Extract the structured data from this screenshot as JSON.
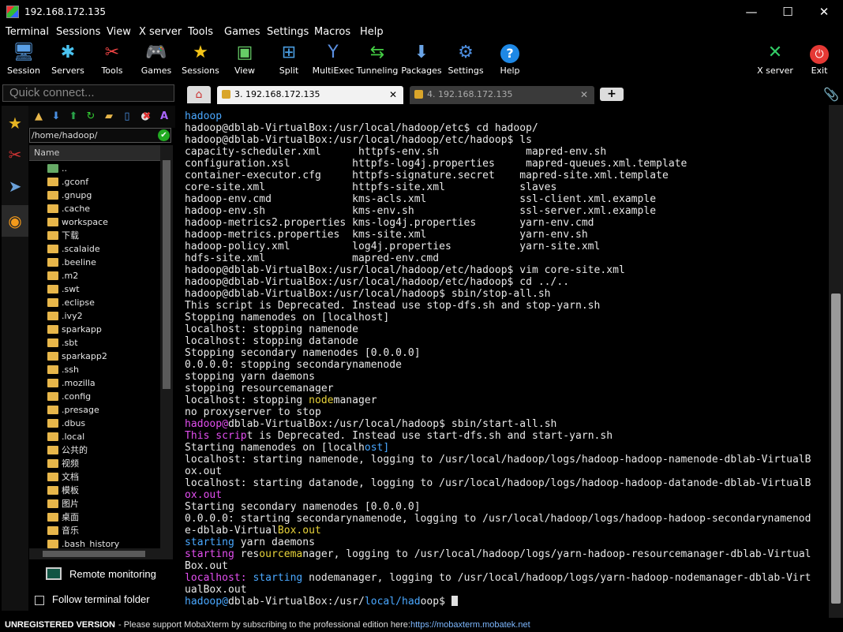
{
  "window": {
    "title": "192.168.172.135",
    "minimize": "—",
    "maximize": "☐",
    "close": "✕"
  },
  "menu": [
    "Terminal",
    "Sessions",
    "View",
    "X server",
    "Tools",
    "Games",
    "Settings",
    "Macros",
    "Help"
  ],
  "toolbar": {
    "items": [
      {
        "label": "Session",
        "icon": "monitor-icon"
      },
      {
        "label": "Servers",
        "icon": "servers-icon"
      },
      {
        "label": "Tools",
        "icon": "tools-icon"
      },
      {
        "label": "Games",
        "icon": "gamepad-icon"
      },
      {
        "label": "Sessions",
        "icon": "star-icon"
      },
      {
        "label": "View",
        "icon": "view-icon"
      },
      {
        "label": "Split",
        "icon": "split-icon"
      },
      {
        "label": "MultiExec",
        "icon": "multiexec-icon"
      },
      {
        "label": "Tunneling",
        "icon": "tunneling-icon"
      },
      {
        "label": "Packages",
        "icon": "packages-icon"
      },
      {
        "label": "Settings",
        "icon": "gears-icon"
      },
      {
        "label": "Help",
        "icon": "help-icon"
      }
    ],
    "xserver": "X server",
    "exit": "Exit"
  },
  "quick_connect": {
    "placeholder": "Quick connect..."
  },
  "sidebar": {
    "path": "/home/hadoop/",
    "column": "Name",
    "files": [
      "..",
      ".gconf",
      ".gnupg",
      ".cache",
      "workspace",
      "下载",
      ".scalaide",
      ".beeline",
      ".m2",
      ".swt",
      ".eclipse",
      ".ivy2",
      "sparkapp",
      ".sbt",
      "sparkapp2",
      ".ssh",
      ".mozilla",
      ".config",
      ".presage",
      ".dbus",
      ".local",
      "公共的",
      "视频",
      "文档",
      "模板",
      "图片",
      "桌面",
      "音乐",
      ".bash_history"
    ],
    "remote_monitoring": "Remote monitoring",
    "follow_terminal": "Follow terminal folder"
  },
  "tabs": {
    "active": "3. 192.168.172.135",
    "inactive": "4. 192.168.172.135",
    "close": "✕",
    "add": "+"
  },
  "terminal": {
    "lines": [
      [
        [
          "hadoop",
          "bl"
        ]
      ],
      [
        [
          "hadoop@dblab-VirtualBox:/usr/local/hadoop/etc$ cd hadoop/",
          ""
        ]
      ],
      [
        [
          "hadoop@dblab-VirtualBox:/usr/local/hadoop/etc/hadoop$ ls",
          ""
        ]
      ],
      [
        [
          "capacity-scheduler.xml      httpfs-env.sh              mapred-env.sh",
          ""
        ]
      ],
      [
        [
          "configuration.xsl          httpfs-",
          ""
        ],
        [
          "log4j",
          ""
        ],
        [
          ".properties     mapred-queues.xml.template",
          ""
        ]
      ],
      [
        [
          "container-executor.cfg     httpfs-signature.secret    mapred-site.xml.template",
          ""
        ]
      ],
      [
        [
          "core-site.xml              httpfs-site.xml            slaves",
          ""
        ]
      ],
      [
        [
          "hadoop-env.cmd             kms-acls.xml               ssl-client.xml.example",
          ""
        ]
      ],
      [
        [
          "hadoop-env.sh              kms-env.sh                 ssl-server.xml.example",
          ""
        ]
      ],
      [
        [
          "hadoop-metrics2.properties kms-log4j.properties       yarn-env.cmd",
          ""
        ]
      ],
      [
        [
          "hadoop-metrics.properties  kms-site.xml               yarn-env.sh",
          ""
        ]
      ],
      [
        [
          "hadoop-policy.xml          log4j.properties           yarn-site.xml",
          ""
        ]
      ],
      [
        [
          "hdfs-site.xml              mapred-env.cmd",
          ""
        ]
      ],
      [
        [
          "hadoop@dblab-VirtualBox:/usr/local/hadoop/etc/hadoop$ vim core-site.xml",
          ""
        ]
      ],
      [
        [
          "hadoop@dblab-VirtualBox:/usr/local/hadoop/etc/hadoop$ cd ../..",
          ""
        ]
      ],
      [
        [
          "hadoop@dblab-VirtualBox:/usr/local/hadoop$ sbin/stop-all.sh",
          ""
        ]
      ],
      [
        [
          "This script is Deprecated. Instead use stop-dfs.sh and stop-yarn.sh",
          ""
        ]
      ],
      [
        [
          "Stopping namenodes on [localhost]",
          ""
        ]
      ],
      [
        [
          "localhost: stopping namenode",
          ""
        ]
      ],
      [
        [
          "localhost: stopping datanode",
          ""
        ]
      ],
      [
        [
          "Stopping secondary namenodes [0.0.0.0]",
          ""
        ]
      ],
      [
        [
          "0.0.0.0: stopping secondarynamenode",
          ""
        ]
      ],
      [
        [
          "stopping yarn daemons",
          ""
        ]
      ],
      [
        [
          "stopping resourcemanager",
          ""
        ]
      ],
      [
        [
          "localhost: stop",
          ""
        ],
        [
          "ping ",
          ""
        ],
        [
          "node",
          "yl"
        ],
        [
          "manager",
          ""
        ]
      ],
      [
        [
          "no proxyserver to stop",
          ""
        ]
      ],
      [
        [
          "hadoop@",
          "mg"
        ],
        [
          "dblab-VirtualBox:/usr/local/hadoop$ sbin/start-all.sh",
          ""
        ]
      ],
      [
        [
          "This scrip",
          "mg"
        ],
        [
          "t is Deprecated. Instead use start-dfs.sh and start-yarn.sh",
          ""
        ]
      ],
      [
        [
          "Starting namenodes on [localh",
          ""
        ],
        [
          "ost]",
          "bl"
        ]
      ],
      [
        [
          "localhost: starting namenode, logging to /usr/local/hadoop/logs/hadoop-hadoop-namenode-dblab-VirtualB",
          ""
        ]
      ],
      [
        [
          "ox.out",
          ""
        ]
      ],
      [
        [
          "localhost: starting datanode, logging to /usr/local/hadoop/logs/hadoop-hadoop-datanode-dblab-VirtualB",
          ""
        ]
      ],
      [
        [
          "ox.out",
          "mg"
        ]
      ],
      [
        [
          "Starting secondary namenodes [0.0.0.0]",
          ""
        ]
      ],
      [
        [
          "0.0.0.0: starting secondarynamenode, logging to /usr/local/hadoop/logs/hadoop-hadoop-secondarynamenod",
          ""
        ]
      ],
      [
        [
          "e-dblab-Virtual",
          ""
        ],
        [
          "Box.out",
          "yl"
        ]
      ],
      [
        [
          "starting",
          "bl"
        ],
        [
          " yarn daemons",
          ""
        ]
      ],
      [
        [
          "starting",
          "mg"
        ],
        [
          " res",
          ""
        ],
        [
          "ourcema",
          "yl"
        ],
        [
          "nager, logging to /usr/local/hadoop/logs/yarn-hadoop-resourcemanager-dblab-Virtual",
          ""
        ]
      ],
      [
        [
          "Box.out",
          ""
        ]
      ],
      [
        [
          "localhost:",
          "mg"
        ],
        [
          " ",
          ""
        ],
        [
          "starting",
          "bl"
        ],
        [
          " nodemanager, logging to /usr/local/hadoop/logs/yarn-hadoop-nodemanager-dblab-Virt",
          ""
        ]
      ],
      [
        [
          "ualBox.out",
          ""
        ]
      ],
      [
        [
          "hadoop@",
          "bl"
        ],
        [
          "dblab-VirtualBox:/usr/",
          ""
        ],
        [
          "local/had",
          "bl"
        ],
        [
          "oop$ ",
          ""
        ]
      ]
    ]
  },
  "status": {
    "unregistered": "UNREGISTERED VERSION",
    "message": "-  Please support MobaXterm by subscribing to the professional edition here:",
    "link": "https://mobaxterm.mobatek.net"
  },
  "colors": {
    "blue": "#4aa8ff",
    "magenta": "#e34ff0",
    "yellow": "#e8d33a"
  }
}
